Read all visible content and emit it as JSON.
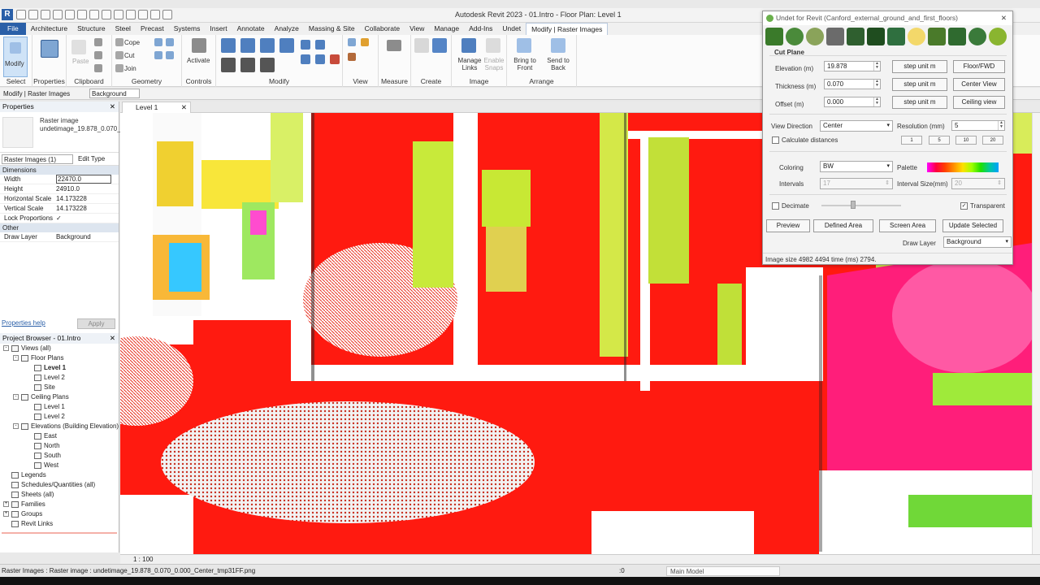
{
  "app": {
    "logo": "R",
    "title": "Autodesk Revit 2023 - 01.Intro - Floor Plan: Level 1"
  },
  "tabs": [
    "File",
    "Architecture",
    "Structure",
    "Steel",
    "Precast",
    "Systems",
    "Insert",
    "Annotate",
    "Analyze",
    "Massing & Site",
    "Collaborate",
    "View",
    "Manage",
    "Add-Ins",
    "Undet",
    "Modify | Raster Images"
  ],
  "ribbon": {
    "groups": [
      "Select",
      "Properties",
      "Clipboard",
      "Geometry",
      "Controls",
      "Modify",
      "View",
      "Measure",
      "Create",
      "Image",
      "Arrange"
    ],
    "modify_label": "Modify",
    "select_label": "Select",
    "properties_label": "Properties",
    "paste_label": "Paste",
    "cope_label": "Cope",
    "cut_label": "Cut",
    "join_label": "Join",
    "activate_label": "Activate",
    "manage_links_label": "Manage Links",
    "enable_snaps_label": "Enable Snaps",
    "bring_front_label": "Bring to Front",
    "send_back_label": "Send to Back"
  },
  "options_bar": {
    "context": "Modify | Raster Images",
    "layer": "Background"
  },
  "properties": {
    "title": "Properties",
    "type_name": "Raster image",
    "type_file": "undetimage_19.878_0.070_0.000_Center_tmp31...",
    "selector": "Raster Images (1)",
    "edit_type": "Edit Type",
    "category_dimensions": "Dimensions",
    "rows": [
      {
        "k": "Width",
        "v": "22470.0"
      },
      {
        "k": "Height",
        "v": "24910.0"
      },
      {
        "k": "Horizontal Scale",
        "v": "14.173228"
      },
      {
        "k": "Vertical Scale",
        "v": "14.173228"
      },
      {
        "k": "Lock Proportions",
        "v": "✓"
      }
    ],
    "category_other": "Other",
    "draw_layer_key": "Draw Layer",
    "draw_layer_value": "Background",
    "help": "Properties help",
    "apply": "Apply"
  },
  "browser": {
    "title": "Project Browser - 01.Intro",
    "nodes": [
      {
        "label": "Views (all)",
        "level": 0,
        "expander": "-"
      },
      {
        "label": "Floor Plans",
        "level": 1,
        "expander": "-"
      },
      {
        "label": "Level 1",
        "level": 2,
        "bold": true
      },
      {
        "label": "Level 2",
        "level": 2
      },
      {
        "label": "Site",
        "level": 2
      },
      {
        "label": "Ceiling Plans",
        "level": 1,
        "expander": "-"
      },
      {
        "label": "Level 1",
        "level": 2
      },
      {
        "label": "Level 2",
        "level": 2
      },
      {
        "label": "Elevations (Building Elevation)",
        "level": 1,
        "expander": "-"
      },
      {
        "label": "East",
        "level": 2
      },
      {
        "label": "North",
        "level": 2
      },
      {
        "label": "South",
        "level": 2
      },
      {
        "label": "West",
        "level": 2
      },
      {
        "label": "Legends",
        "level": 0
      },
      {
        "label": "Schedules/Quantities (all)",
        "level": 0
      },
      {
        "label": "Sheets (all)",
        "level": 0
      },
      {
        "label": "Families",
        "level": 0,
        "expander": "+"
      },
      {
        "label": "Groups",
        "level": 0,
        "expander": "+"
      },
      {
        "label": "Revit Links",
        "level": 0
      }
    ]
  },
  "view": {
    "tab": "Level 1",
    "scale": "1 : 100"
  },
  "status": {
    "text": "Raster Images : Raster image : undetimage_19.878_0.070_0.000_Center_tmp31FF.png",
    "model": "Main Model",
    "count": ":0"
  },
  "undet": {
    "title": "Undet for Revit (Canford_external_ground_and_first_floors)",
    "section": "Cut Plane",
    "elevation_label": "Elevation (m)",
    "elevation": "19.878",
    "thickness_label": "Thickness (m)",
    "thickness": "0.070",
    "offset_label": "Offset (m)",
    "offset": "0.000",
    "step_label": "step unit m",
    "floor_fwd": "Floor/FWD",
    "center_view": "Center View",
    "ceiling_view": "Ceiling view",
    "view_direction_label": "View Direction",
    "view_direction": "Center",
    "resolution_label": "Resolution (mm)",
    "resolution": "5",
    "calc_distances": "Calculate distances",
    "res_buttons": [
      "1",
      "5",
      "10",
      "20"
    ],
    "coloring_label": "Coloring",
    "coloring": "BW",
    "palette_label": "Palette",
    "intervals_label": "Intervals",
    "intervals": "17",
    "interval_size_label": "Interval Size(mm)",
    "interval_size": "20",
    "decimate": "Decimate",
    "transparent": "Transparent",
    "preview": "Preview",
    "defined_area": "Defined Area",
    "screen_area": "Screen Area",
    "update_selected": "Update Selected",
    "draw_layer_label": "Draw Layer",
    "draw_layer": "Background",
    "info": "Image size 4982 4494 time (ms) 2794."
  }
}
